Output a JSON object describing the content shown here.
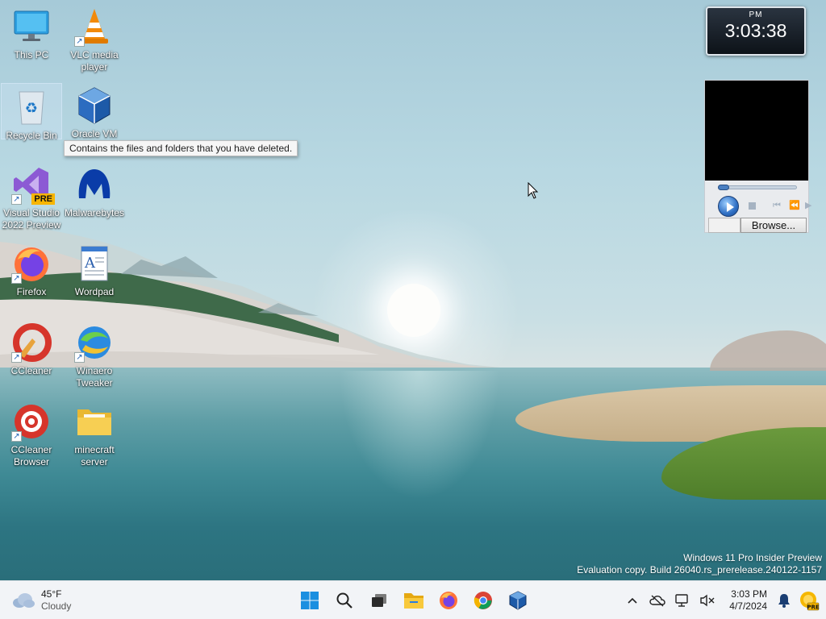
{
  "desktop": {
    "icons": [
      {
        "label": "This PC",
        "icon": "computer-icon"
      },
      {
        "label": "VLC media player",
        "icon": "vlc-icon"
      },
      {
        "label": "Recycle Bin",
        "icon": "recycle-bin-icon"
      },
      {
        "label": "Oracle VM",
        "icon": "virtualbox-icon"
      },
      {
        "label": "Visual Studio 2022 Preview",
        "icon": "visual-studio-icon",
        "badge": "PRE"
      },
      {
        "label": "Malwarebytes",
        "icon": "malwarebytes-icon"
      },
      {
        "label": "Firefox",
        "icon": "firefox-icon"
      },
      {
        "label": "Wordpad",
        "icon": "wordpad-icon"
      },
      {
        "label": "CCleaner",
        "icon": "ccleaner-icon"
      },
      {
        "label": "Winaero Tweaker",
        "icon": "winaero-icon"
      },
      {
        "label": "CCleaner Browser",
        "icon": "ccleaner-browser-icon"
      },
      {
        "label": "minecraft server",
        "icon": "folder-icon"
      }
    ],
    "tooltip": "Contains the files and folders that you have deleted."
  },
  "clock_gadget": {
    "ampm": "PM",
    "time": "3:03:38"
  },
  "media_gadget": {
    "browse_label": "Browse...",
    "seek_fraction": 0.0
  },
  "watermark": {
    "line1": "Windows 11 Pro Insider Preview",
    "line2": "Evaluation copy. Build 26040.rs_prerelease.240122-1157"
  },
  "taskbar": {
    "weather": {
      "temp": "45°F",
      "condition": "Cloudy",
      "icon": "cloud-icon"
    },
    "apps": [
      "start-icon",
      "search-icon",
      "task-view-icon",
      "file-explorer-icon",
      "firefox-icon",
      "chrome-icon",
      "virtualbox-icon"
    ],
    "tray": {
      "time": "3:03 PM",
      "date": "4/7/2024",
      "icons": [
        "chevron-up-icon",
        "onedrive-icon",
        "network-icon",
        "volume-muted-icon",
        "notification-bell-icon",
        "copilot-pre-icon"
      ]
    }
  },
  "colors": {
    "taskbar_bg": "#f2f4f7",
    "accent": "#0067c0"
  }
}
